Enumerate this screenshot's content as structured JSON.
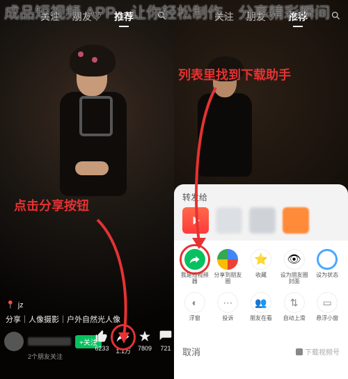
{
  "overlay_title": "成品短视频 APP，让你轻松制作、分享精彩瞬间",
  "annotation_left": "点击分享按钮",
  "annotation_right": "列表里找到下载助手",
  "left": {
    "tabs": [
      "关注",
      "朋友♡",
      "推荐"
    ],
    "active_tab": "推荐",
    "user_tag": "jz",
    "caption": "分享｜人像摄影｜户外自然光人像",
    "follow_btn": "+关注",
    "fan_note": "2个朋友关注",
    "engagement": {
      "like": "6233",
      "share": "1.1万",
      "fav": "7809",
      "comment": "721"
    }
  },
  "right": {
    "tabs": [
      "关注",
      "朋友♡",
      "推荐"
    ],
    "active_tab": "推荐",
    "sheet_title": "转发给",
    "grid": [
      "我是短视频器",
      "分享到朋友圈",
      "收藏",
      "设为朋友圈封面",
      "设为状态",
      "浮窗",
      "投诉",
      "朋友在看",
      "自动上滑",
      "悬浮小窗"
    ],
    "cancel": "取消",
    "brand": "下载视频号"
  }
}
